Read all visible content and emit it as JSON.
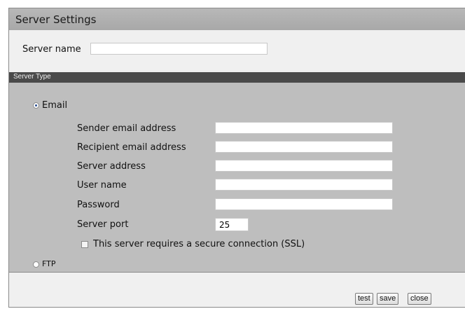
{
  "window": {
    "title": "Server Settings"
  },
  "server_name": {
    "label": "Server name",
    "value": ""
  },
  "server_type": {
    "section_title": "Server Type",
    "email": {
      "label": "Email",
      "selected": true,
      "fields": [
        {
          "label": "Sender email address",
          "value": ""
        },
        {
          "label": "Recipient email address",
          "value": ""
        },
        {
          "label": "Server address",
          "value": ""
        },
        {
          "label": "User name",
          "value": ""
        },
        {
          "label": "Password",
          "value": ""
        },
        {
          "label": "Server port",
          "value": "25"
        }
      ],
      "ssl": {
        "label": "This server requires a secure connection (SSL)",
        "checked": false
      }
    },
    "ftp": {
      "label": "FTP",
      "selected": false
    }
  },
  "buttons": {
    "test": "test",
    "save": "save",
    "close": "close"
  }
}
